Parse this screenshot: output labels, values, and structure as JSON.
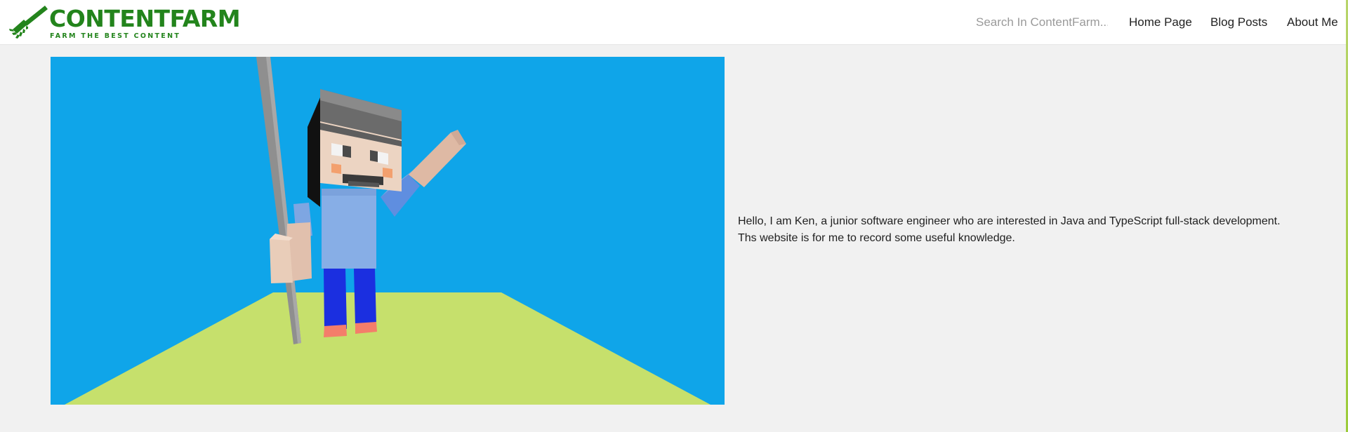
{
  "header": {
    "logo": {
      "name": "CONTENTFARM",
      "tagline": "FARM THE BEST CONTENT",
      "icon": "rake-icon"
    },
    "search": {
      "placeholder": "Search In ContentFarm...",
      "value": ""
    },
    "nav": {
      "home": "Home Page",
      "blog": "Blog Posts",
      "about": "About Me"
    }
  },
  "main": {
    "intro": {
      "line1": "Hello, I am Ken, a junior software engineer who are interested in Java and TypeScript full-stack development.",
      "line2": "Ths website is for me to record some useful knowledge."
    }
  },
  "colors": {
    "brand": "#23841c",
    "sky": "#0fa5e9",
    "ground": "#c6e06c",
    "page_bg": "#f1f1f1"
  }
}
